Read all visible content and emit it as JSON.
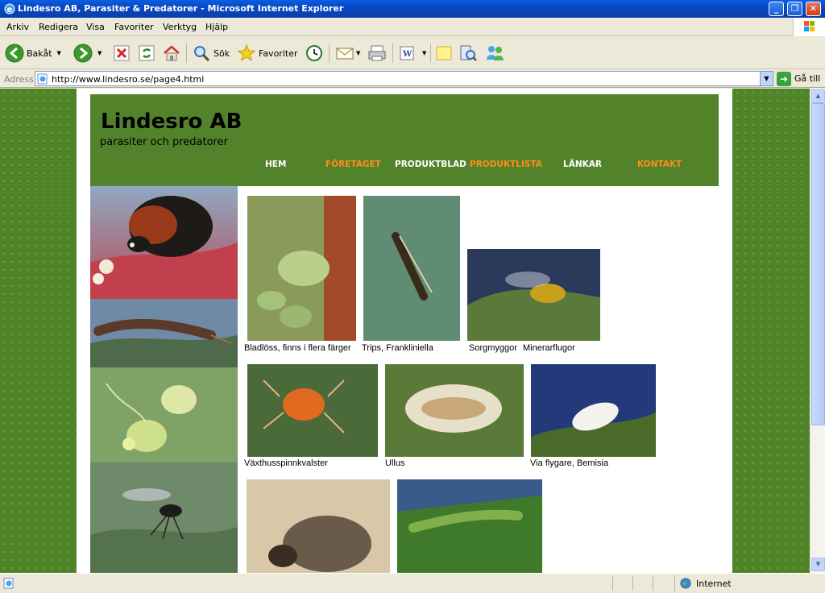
{
  "window": {
    "title": "Lindesro AB, Parasiter & Predatorer - Microsoft Internet Explorer",
    "minimize": "_",
    "maximize": "❐",
    "close": "✕"
  },
  "menu": [
    "Arkiv",
    "Redigera",
    "Visa",
    "Favoriter",
    "Verktyg",
    "Hjälp"
  ],
  "toolbar": {
    "back_label": "Bakåt",
    "search_label": "Sök",
    "favorites_label": "Favoriter"
  },
  "address": {
    "label": "Adress",
    "url": "http://www.lindesro.se/page4.html",
    "go_label": "Gå till"
  },
  "site": {
    "name": "Lindesro AB",
    "tagline": "parasiter och predatorer",
    "nav": [
      "HEM",
      "FÖRETAGET",
      "PRODUKTBLAD",
      "PRODUKTLISTA",
      "LÄNKAR",
      "KONTAKT"
    ]
  },
  "gallery": {
    "row1": [
      "Bladlöss, finns i flera färger",
      "Trips, Frankliniella",
      "Sorgmyggor",
      "Minerarflugor"
    ],
    "row2": [
      "Växthusspinnkvalster",
      "Ullus",
      "Via flygare, Bemisia"
    ]
  },
  "status": {
    "zone": "Internet"
  },
  "colors": {
    "header_green": "#52832a",
    "nav_orange": "#ff8c1a",
    "nav_white": "#ffffff",
    "background_green": "#4f8428"
  }
}
